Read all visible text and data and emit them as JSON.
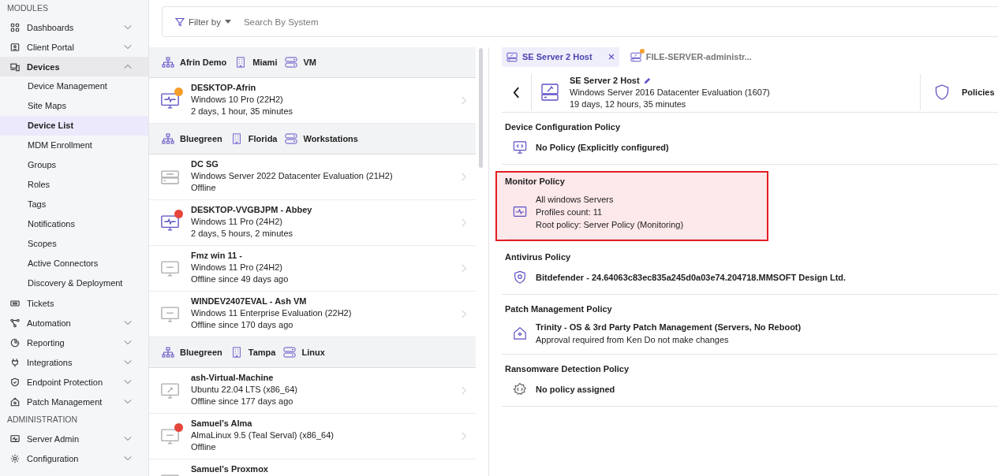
{
  "sidebar": {
    "sections": [
      {
        "heading": "MODULES",
        "items": [
          {
            "label": "Dashboards",
            "expandable": true,
            "expanded": false,
            "selected": false
          },
          {
            "label": "Client Portal",
            "expandable": true,
            "expanded": false,
            "selected": false
          },
          {
            "label": "Devices",
            "expandable": true,
            "expanded": true,
            "selected": true,
            "children": [
              {
                "label": "Device Management",
                "selected": false
              },
              {
                "label": "Site Maps",
                "selected": false
              },
              {
                "label": "Device List",
                "selected": true
              },
              {
                "label": "MDM Enrollment",
                "selected": false
              },
              {
                "label": "Groups",
                "selected": false
              },
              {
                "label": "Roles",
                "selected": false
              },
              {
                "label": "Tags",
                "selected": false
              },
              {
                "label": "Notifications",
                "selected": false
              },
              {
                "label": "Scopes",
                "selected": false
              },
              {
                "label": "Active Connectors",
                "selected": false
              },
              {
                "label": "Discovery & Deployment",
                "selected": false
              }
            ]
          },
          {
            "label": "Tickets",
            "expandable": false,
            "expanded": false,
            "selected": false
          },
          {
            "label": "Automation",
            "expandable": true,
            "expanded": false,
            "selected": false
          },
          {
            "label": "Reporting",
            "expandable": true,
            "expanded": false,
            "selected": false
          },
          {
            "label": "Integrations",
            "expandable": true,
            "expanded": false,
            "selected": false
          },
          {
            "label": "Endpoint Protection",
            "expandable": true,
            "expanded": false,
            "selected": false
          },
          {
            "label": "Patch Management",
            "expandable": true,
            "expanded": false,
            "selected": false
          }
        ]
      },
      {
        "heading": "ADMINISTRATION",
        "items": [
          {
            "label": "Server Admin",
            "expandable": true,
            "expanded": false,
            "selected": false
          },
          {
            "label": "Configuration",
            "expandable": true,
            "expanded": false,
            "selected": false
          }
        ]
      }
    ]
  },
  "filter": {
    "label": "Filter by",
    "placeholder": "Search By System"
  },
  "device_list": [
    {
      "kind": "group",
      "client": "Afrin Demo",
      "site": "Miami",
      "group": "VM"
    },
    {
      "kind": "desktop",
      "online": true,
      "color": "#f59e2b",
      "name": "DESKTOP-Afrin",
      "os": "Windows 10 Pro (22H2)",
      "status": "2 days, 1 hour, 35 minutes"
    },
    {
      "kind": "group",
      "client": "Bluegreen",
      "site": "Florida",
      "group": "Workstations"
    },
    {
      "kind": "server",
      "online": false,
      "name": "DC SG",
      "os": "Windows Server 2022 Datacenter Evaluation (21H2)",
      "status": "Offline"
    },
    {
      "kind": "desktop",
      "online": true,
      "color": "#e5453b",
      "name": "DESKTOP-VVGBJPM - Abbey",
      "os": "Windows 11 Pro (24H2)",
      "status": "2 days, 5 hours, 2 minutes"
    },
    {
      "kind": "desktop",
      "online": false,
      "name": "Fmz win 11 -",
      "os": "Windows 11 Pro (24H2)",
      "status": "Offline since 49 days ago"
    },
    {
      "kind": "desktop",
      "online": false,
      "name": "WINDEV2407EVAL - Ash VM",
      "os": "Windows 11 Enterprise Evaluation (22H2)",
      "status": "Offline since 170 days ago"
    },
    {
      "kind": "group",
      "client": "Bluegreen",
      "site": "Tampa",
      "group": "Linux"
    },
    {
      "kind": "tool",
      "online": false,
      "name": "ash-Virtual-Machine",
      "os": "Ubuntu 22.04 LTS (x86_64)",
      "status": "Offline since 177 days ago"
    },
    {
      "kind": "desktop",
      "online": false,
      "color": "#e5453b",
      "name": "Samuel's Alma",
      "os": "AlmaLinux 9.5 (Teal Serval) (x86_64)",
      "status": "Offline"
    },
    {
      "kind": "desktop",
      "online": false,
      "name": "Samuel's Proxmox"
    }
  ],
  "tabs": [
    {
      "label": "SE Server 2 Host",
      "selected": true
    },
    {
      "label": "FILE-SERVER-administr...",
      "selected": false,
      "color": "#f59e2b"
    }
  ],
  "device": {
    "name": "SE Server 2 Host",
    "os": "Windows Server 2016 Datacenter Evaluation (1607)",
    "uptime": "19 days, 12 hours, 35 minutes",
    "section": "Policies"
  },
  "policies": [
    {
      "title": "Device Configuration Policy",
      "highlighted": false,
      "lines": [
        {
          "text": "No Policy (Explicitly configured)",
          "emphasis": true
        }
      ]
    },
    {
      "title": "Monitor Policy",
      "highlighted": true,
      "lines": [
        {
          "text": "All windows Servers",
          "emphasis": false
        },
        {
          "text": "Profiles count: 11",
          "emphasis": false
        },
        {
          "text": "Root policy: Server Policy (Monitoring)",
          "emphasis": false
        }
      ]
    },
    {
      "title": "Antivirus Policy",
      "highlighted": false,
      "lines": [
        {
          "text": "Bitdefender - 24.64063c83ec835a245d0a03e74.204718.MMSOFT Design Ltd.",
          "emphasis": true
        }
      ]
    },
    {
      "title": "Patch Management Policy",
      "highlighted": false,
      "lines": [
        {
          "text": "Trinity - OS & 3rd Party Patch Management (Servers, No Reboot)",
          "emphasis": true
        },
        {
          "text": "Approval required from Ken Do not make changes",
          "emphasis": false
        }
      ]
    },
    {
      "title": "Ransomware Detection Policy",
      "highlighted": false,
      "lines": [
        {
          "text": "No policy assigned",
          "emphasis": true
        }
      ]
    }
  ]
}
